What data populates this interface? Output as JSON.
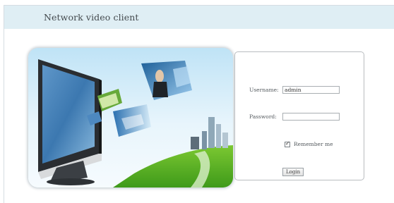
{
  "header": {
    "title": "Network video client"
  },
  "login": {
    "username_label": "Username:",
    "username_value": "admin",
    "password_label": "Password:",
    "password_value": "",
    "remember_label": "Remember me",
    "remember_checked": true,
    "login_button": "Login"
  },
  "colors": {
    "header_bg": "#dfeef4",
    "panel_border": "#b9bdc0"
  }
}
